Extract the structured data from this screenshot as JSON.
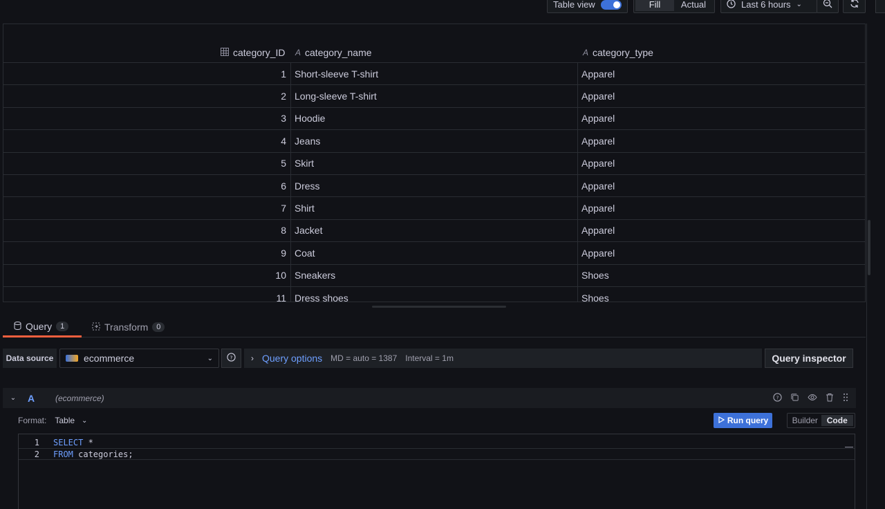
{
  "toolbar": {
    "table_view_label": "Table view",
    "fill_label": "Fill",
    "actual_label": "Actual",
    "time_range": "Last 6 hours"
  },
  "table": {
    "columns": [
      {
        "name": "category_ID",
        "icon": "table-grid-icon"
      },
      {
        "name": "category_name",
        "icon": "text-type-icon"
      },
      {
        "name": "category_type",
        "icon": "text-type-icon"
      }
    ],
    "rows": [
      {
        "id": "1",
        "name": "Short-sleeve T-shirt",
        "type": "Apparel"
      },
      {
        "id": "2",
        "name": "Long-sleeve T-shirt",
        "type": "Apparel"
      },
      {
        "id": "3",
        "name": "Hoodie",
        "type": "Apparel"
      },
      {
        "id": "4",
        "name": "Jeans",
        "type": "Apparel"
      },
      {
        "id": "5",
        "name": "Skirt",
        "type": "Apparel"
      },
      {
        "id": "6",
        "name": "Dress",
        "type": "Apparel"
      },
      {
        "id": "7",
        "name": "Shirt",
        "type": "Apparel"
      },
      {
        "id": "8",
        "name": "Jacket",
        "type": "Apparel"
      },
      {
        "id": "9",
        "name": "Coat",
        "type": "Apparel"
      },
      {
        "id": "10",
        "name": "Sneakers",
        "type": "Shoes"
      },
      {
        "id": "11",
        "name": "Dress shoes",
        "type": "Shoes"
      }
    ]
  },
  "tabs": {
    "query_label": "Query",
    "query_count": "1",
    "transform_label": "Transform",
    "transform_count": "0"
  },
  "query_bar": {
    "data_source_label": "Data source",
    "data_source_value": "ecommerce",
    "query_options_label": "Query options",
    "md_info": "MD = auto = 1387",
    "interval_info": "Interval = 1m",
    "inspector_label": "Query inspector"
  },
  "query_a": {
    "letter": "A",
    "ds_name": "(ecommerce)",
    "format_label": "Format:",
    "format_value": "Table",
    "run_label": "Run query",
    "builder_label": "Builder",
    "code_label": "Code",
    "lines": [
      {
        "num": "1",
        "kw": "SELECT",
        "rest": " *"
      },
      {
        "num": "2",
        "kw": "FROM",
        "rest": " categories;"
      }
    ]
  },
  "colors": {
    "accent": "#3d71d9",
    "tab_active": "#f55f3e",
    "link": "#6e9fff"
  }
}
